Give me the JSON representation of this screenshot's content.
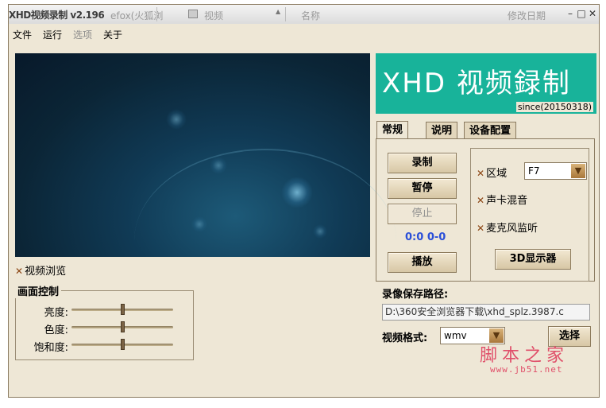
{
  "titlebar": {
    "app_title": "XHD视频录制 v2.196",
    "ghost_browser_text": "efox(火狐浏",
    "ghost_video_text": "视频",
    "ghost_name_col": "名称",
    "ghost_date_col": "修改日期",
    "minimize": "–",
    "maximize": "□",
    "close": "✕"
  },
  "menu": {
    "items": [
      "文件",
      "运行",
      "选项",
      "关于"
    ]
  },
  "left": {
    "video_preview_label": "视频浏览",
    "group_title": "画面控制",
    "sliders": [
      {
        "label": "亮度:",
        "value": 0.5
      },
      {
        "label": "色度:",
        "value": 0.5
      },
      {
        "label": "饱和度:",
        "value": 0.5
      }
    ]
  },
  "banner": {
    "title": "XHD 视频録制",
    "since": "since(20150318)",
    "color": "#18b39a"
  },
  "tabs": [
    "常规",
    "说明",
    "设备配置"
  ],
  "controls": {
    "record": "录制",
    "pause": "暂停",
    "stop": "停止",
    "timecode": "0:0  0-0",
    "play": "播放"
  },
  "options": {
    "region_label": "区域",
    "region_value": "F7",
    "sound_mix_label": "声卡混音",
    "mic_monitor_label": "麦克风监听",
    "display_button": "3D显示器"
  },
  "output": {
    "path_label": "录像保存路径:",
    "path_value": "D:\\360安全浏览器下载\\xhd_splz.3987.c",
    "format_label": "视频格式:",
    "format_value": "wmv",
    "choose_button": "选择"
  },
  "watermark": {
    "text": "脚本之家",
    "url": "www.jb51.net"
  }
}
